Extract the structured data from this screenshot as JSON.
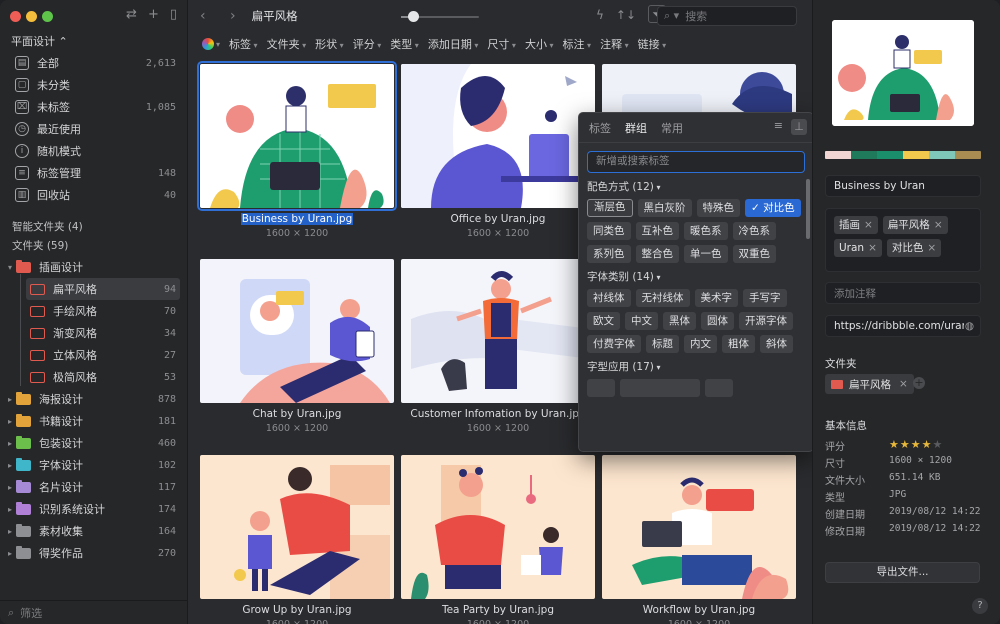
{
  "sidebar": {
    "library": "平面设计 ⌃",
    "nav": [
      {
        "label": "全部",
        "count": "2,613",
        "icon": "all-items-icon"
      },
      {
        "label": "未分类",
        "count": "",
        "icon": "uncategorized-icon"
      },
      {
        "label": "未标签",
        "count": "1,085",
        "icon": "untagged-icon"
      },
      {
        "label": "最近使用",
        "count": "",
        "icon": "recent-clock-icon"
      },
      {
        "label": "随机模式",
        "count": "",
        "icon": "random-bulb-icon"
      },
      {
        "label": "标签管理",
        "count": "148",
        "icon": "tag-manager-icon"
      },
      {
        "label": "回收站",
        "count": "40",
        "icon": "trash-icon"
      }
    ],
    "smart_folders": "智能文件夹 (4)",
    "folders_header": "文件夹 (59)",
    "folders": [
      {
        "label": "插画设计",
        "count": "",
        "color": "#e05a4f",
        "expanded": true
      },
      {
        "label": "扁平风格",
        "count": "94",
        "color": "#e05a4f",
        "sub": true,
        "selected": true
      },
      {
        "label": "手绘风格",
        "count": "70",
        "color": "#e05a4f",
        "sub": true
      },
      {
        "label": "渐变风格",
        "count": "34",
        "color": "#e05a4f",
        "sub": true
      },
      {
        "label": "立体风格",
        "count": "27",
        "color": "#e05a4f",
        "sub": true
      },
      {
        "label": "极简风格",
        "count": "53",
        "color": "#e05a4f",
        "sub": true
      },
      {
        "label": "海报设计",
        "count": "878",
        "color": "#e3a33b"
      },
      {
        "label": "书籍设计",
        "count": "181",
        "color": "#e3a33b"
      },
      {
        "label": "包装设计",
        "count": "460",
        "color": "#6cbf4a"
      },
      {
        "label": "字体设计",
        "count": "102",
        "color": "#3fb6c9"
      },
      {
        "label": "名片设计",
        "count": "117",
        "color": "#a78ad6"
      },
      {
        "label": "识别系统设计",
        "count": "174",
        "color": "#b07fd6"
      },
      {
        "label": "素材收集",
        "count": "164",
        "color": "#8e8f92"
      },
      {
        "label": "得奖作品",
        "count": "270",
        "color": "#8e8f92"
      }
    ],
    "filter_placeholder": "筛选"
  },
  "toolbar": {
    "breadcrumb": "扁平风格",
    "zoom_level": 0.15,
    "search_placeholder": "搜索",
    "filters": [
      "标签",
      "文件夹",
      "形状",
      "评分",
      "类型",
      "添加日期",
      "尺寸",
      "大小",
      "标注",
      "注释",
      "链接"
    ]
  },
  "grid": {
    "items": [
      {
        "name": "Business by Uran.jpg",
        "dims": "1600 × 1200",
        "selected": true,
        "bg": "#ffffff"
      },
      {
        "name": "Office by Uran.jpg",
        "dims": "1600 × 1200",
        "bg": "#ffffff"
      },
      {
        "name": "",
        "dims": "",
        "bg": "#eef1f8"
      },
      {
        "name": "Chat by Uran.jpg",
        "dims": "1600 × 1200",
        "bg": "#f3f4fb"
      },
      {
        "name": "Customer Infomation by Uran.jpg",
        "dims": "1600 × 1200",
        "bg": "#f4f5fa"
      },
      {
        "name": "Grow Up by Uran.jpg",
        "dims": "1600 × 1200",
        "bg": "#fde6cf"
      },
      {
        "name": "Tea Party by Uran.jpg",
        "dims": "1600 × 1200",
        "bg": "#fde6cf"
      },
      {
        "name": "Workflow by Uran.jpg",
        "dims": "1600 × 1200",
        "bg": "#fde6cf"
      }
    ]
  },
  "popup": {
    "tabs": [
      "标签",
      "群组",
      "常用"
    ],
    "active_tab": "群组",
    "input_placeholder": "新增或搜索标签",
    "groups": [
      {
        "title": "配色方式 (12)",
        "chips": [
          "渐层色",
          "黑白灰阶",
          "特殊色",
          "✓ 对比色",
          "同类色",
          "互补色",
          "暖色系",
          "冷色系",
          "系列色",
          "整合色",
          "单一色",
          "双重色"
        ]
      },
      {
        "title": "字体类别 (14)",
        "chips": [
          "衬线体",
          "无衬线体",
          "美术字",
          "手写字",
          "欧文",
          "中文",
          "黑体",
          "圆体",
          "开源字体",
          "付费字体",
          "标题",
          "内文",
          "粗体",
          "斜体"
        ]
      },
      {
        "title": "字型应用 (17)",
        "chips": []
      }
    ]
  },
  "inspector": {
    "palette": [
      "#f2d6d3",
      "#1f7a5c",
      "#1a8e6b",
      "#f2c94c",
      "#7fc7b9",
      "#a98c52"
    ],
    "title": "Business by Uran",
    "tags": [
      "插画",
      "扁平风格",
      "Uran",
      "对比色"
    ],
    "annotation_placeholder": "添加注释",
    "url": "https://dribbble.com/uranc",
    "folder_label": "文件夹",
    "folder_tag": "扁平风格",
    "info_label": "基本信息",
    "info": [
      {
        "k": "评分",
        "v": ""
      },
      {
        "k": "尺寸",
        "v": "1600 × 1200"
      },
      {
        "k": "文件大小",
        "v": "651.14 KB"
      },
      {
        "k": "类型",
        "v": "JPG"
      },
      {
        "k": "创建日期",
        "v": "2019/08/12 14:22"
      },
      {
        "k": "修改日期",
        "v": "2019/08/12 14:22"
      }
    ],
    "rating": 4,
    "export_label": "导出文件...",
    "help": "?"
  }
}
